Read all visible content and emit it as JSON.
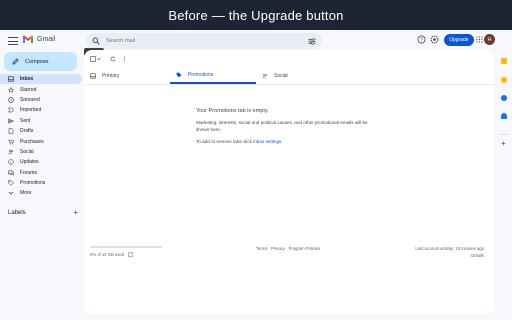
{
  "banner": {
    "text": "Before  —  the Upgrade button"
  },
  "header": {
    "logo_text": "Gmail",
    "search_placeholder": "Search mail",
    "tooltip": "Search",
    "upgrade_label": "Upgrade",
    "avatar_letter": "H"
  },
  "compose": {
    "label": "Compose"
  },
  "sidebar": {
    "items": [
      {
        "label": "Inbox",
        "icon": "inbox-icon"
      },
      {
        "label": "Starred",
        "icon": "star-icon"
      },
      {
        "label": "Snoozed",
        "icon": "clock-icon"
      },
      {
        "label": "Important",
        "icon": "important-icon"
      },
      {
        "label": "Sent",
        "icon": "send-icon"
      },
      {
        "label": "Drafts",
        "icon": "draft-icon"
      },
      {
        "label": "Purchases",
        "icon": "purchases-icon"
      },
      {
        "label": "Social",
        "icon": "social-icon"
      },
      {
        "label": "Updates",
        "icon": "updates-icon"
      },
      {
        "label": "Forums",
        "icon": "forums-icon"
      },
      {
        "label": "Promotions",
        "icon": "tag-icon"
      },
      {
        "label": "More",
        "icon": "chevron-down-icon"
      }
    ],
    "labels_title": "Labels"
  },
  "tabs": [
    {
      "label": "Primary",
      "icon": "inbox-icon"
    },
    {
      "label": "Promotions",
      "icon": "tag-icon"
    },
    {
      "label": "Social",
      "icon": "social-icon"
    }
  ],
  "empty_state": {
    "title": "Your Promotions tab is empty.",
    "description": "Marketing, interests, social and political causes, and other promotional emails will be shown here.",
    "link_prefix": "To add or remove tabs click ",
    "link_text": "inbox settings",
    "link_suffix": "."
  },
  "footer": {
    "storage": "0% of 15 GB used",
    "links": "Terms · Privacy · Program Policies",
    "activity": "Last account activity: 10 minutes ago",
    "details": "Details"
  },
  "colors": {
    "accent": "#0b57d0",
    "compose_bg": "#c2e7ff",
    "active_nav_bg": "#d3e3fd",
    "banner_bg": "#1e2433"
  }
}
